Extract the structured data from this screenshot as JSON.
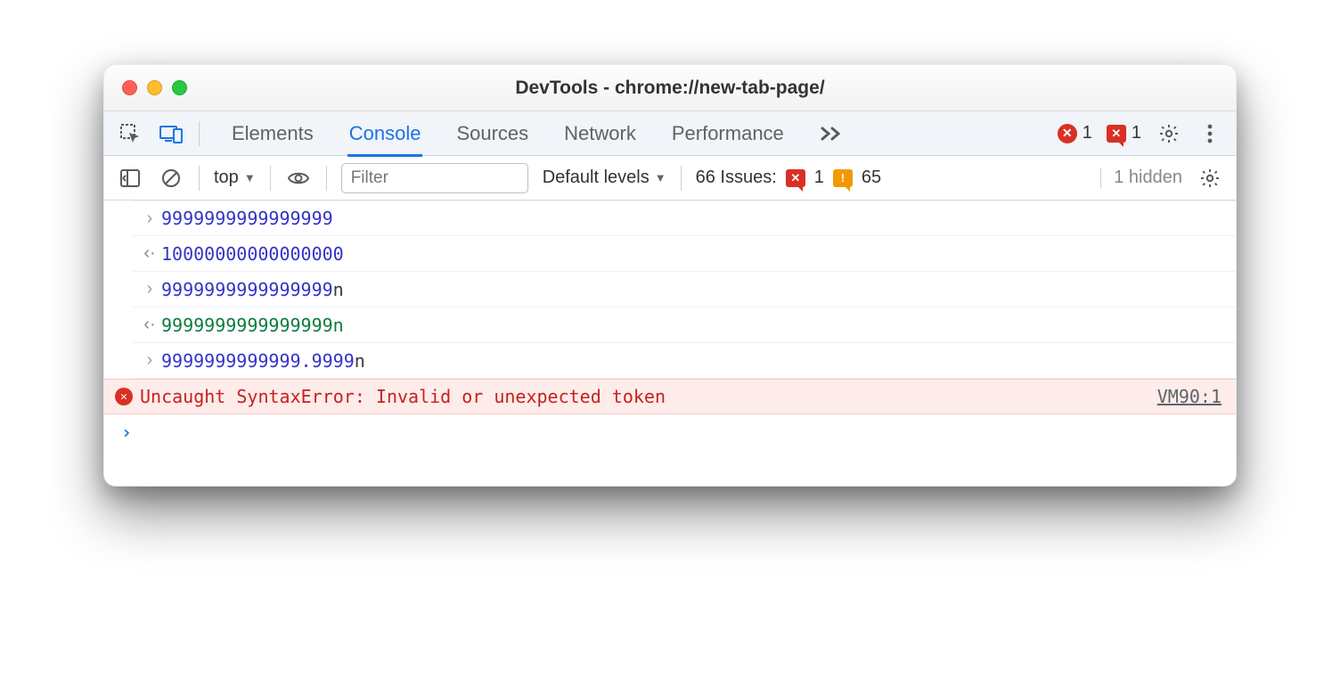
{
  "window": {
    "title": "DevTools - chrome://new-tab-page/"
  },
  "tabs": {
    "elements": "Elements",
    "console": "Console",
    "sources": "Sources",
    "network": "Network",
    "performance": "Performance"
  },
  "toolbar_right": {
    "error_count": "1",
    "issue_error_count": "1"
  },
  "subbar": {
    "context": "top",
    "filter_placeholder": "Filter",
    "levels": "Default levels",
    "issues_label": "66 Issues:",
    "issues_err": "1",
    "issues_warn": "65",
    "hidden": "1 hidden"
  },
  "rows": {
    "r0": {
      "val": "9999999999999999"
    },
    "r1": {
      "val": "10000000000000000"
    },
    "r2": {
      "val": "9999999999999999",
      "suffix": "n"
    },
    "r3": {
      "val": "9999999999999999",
      "suffix": "n"
    },
    "r4": {
      "val": "9999999999999.9999",
      "suffix": "n"
    }
  },
  "error": {
    "message": "Uncaught SyntaxError: Invalid or unexpected token",
    "source": "VM90:1"
  }
}
